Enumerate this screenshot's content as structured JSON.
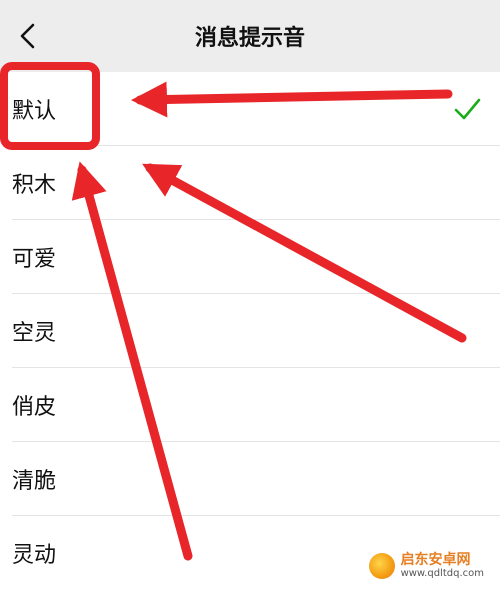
{
  "nav": {
    "title": "消息提示音"
  },
  "items": [
    {
      "label": "默认",
      "selected": true
    },
    {
      "label": "积木",
      "selected": false
    },
    {
      "label": "可爱",
      "selected": false
    },
    {
      "label": "空灵",
      "selected": false
    },
    {
      "label": "俏皮",
      "selected": false
    },
    {
      "label": "清脆",
      "selected": false
    },
    {
      "label": "灵动",
      "selected": false
    }
  ],
  "colors": {
    "check": "#1aad19",
    "annotation": "#e8262a",
    "nav_bg": "#ededed"
  },
  "watermark": {
    "brand": "启东安卓网",
    "url": "www.qdltdq.com"
  }
}
